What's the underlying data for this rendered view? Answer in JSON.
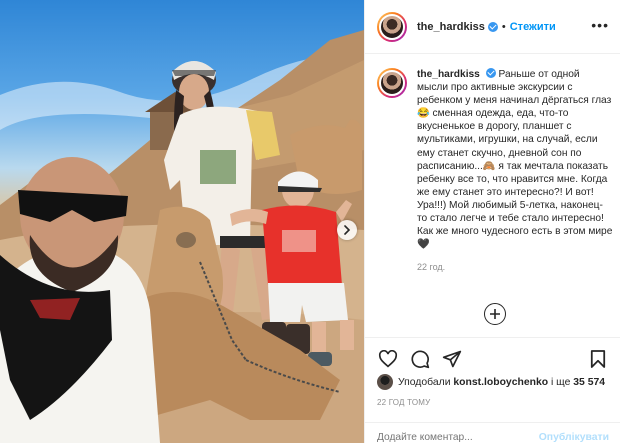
{
  "header": {
    "username": "the_hardkiss",
    "separator": "•",
    "follow_label": "Стежити"
  },
  "caption": {
    "username": "the_hardkiss",
    "text": "Раньше от одной мысли про активные экскурсии с ребенком у меня начинал дёргаться глаз😂 сменная одежда, еда, что-то вкусненькое в дорогу, планшет с мультиками, игрушки, на случай, если ему станет скучно, дневной сон по расписанию...🙈 я так мечтала показать ребенку все то, что нравится мне. Когда же ему станет это интересно?! И вот! Ура!!!) Мой любимый 5-летка, наконец-то стало легче и тебе стало интересно! Как же много чудесного есть в этом мире 🖤",
    "age": "22 год."
  },
  "likes": {
    "prefix": "Уподобали",
    "user": "konst.loboychenko",
    "middle": "і ще",
    "count": "35 574"
  },
  "post_date": "22 ГОД ТОМУ",
  "comment": {
    "placeholder": "Додайте коментар...",
    "post_label": "Опублікувати"
  },
  "colors": {
    "accent": "#0095f6",
    "verified": "#3897f0",
    "muted": "#8e8e8e",
    "post_disabled": "#b2dffc"
  },
  "icons": [
    "verified-badge-icon",
    "more-options-icon",
    "add-comment-icon",
    "heart-icon",
    "comment-icon",
    "share-icon",
    "bookmark-icon",
    "chevron-right-icon"
  ]
}
